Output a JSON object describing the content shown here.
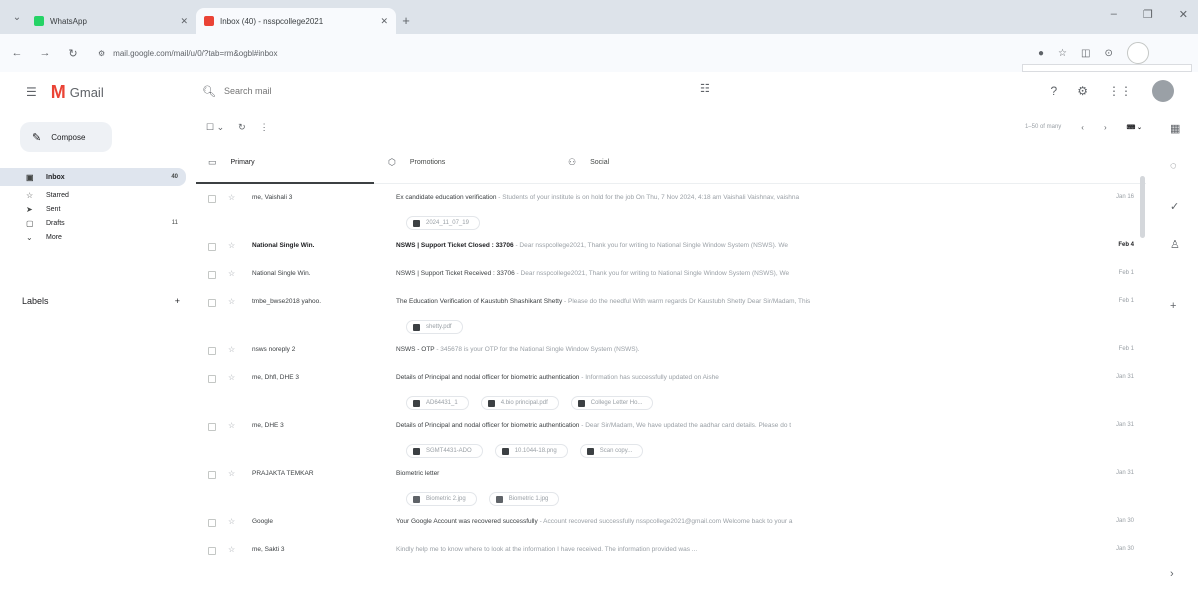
{
  "browser": {
    "tabs": [
      {
        "label": "WhatsApp",
        "favicon_color": "#25d366",
        "active": false
      },
      {
        "label": "Inbox (40) - nsspcollege2021",
        "favicon_color": "#ea4335",
        "active": true
      }
    ],
    "url": "mail.google.com/mail/u/0/?tab=rm&ogbl#inbox"
  },
  "gmail": {
    "app_name": "Gmail",
    "search_placeholder": "Search mail"
  },
  "sidebar": {
    "compose_label": "Compose",
    "items": [
      {
        "icon": "inbox-icon",
        "glyph": "▣",
        "label": "Inbox",
        "count": "40",
        "active": true
      },
      {
        "icon": "star-icon",
        "glyph": "☆",
        "label": "Starred",
        "count": "",
        "active": false
      },
      {
        "icon": "send-icon",
        "glyph": "➤",
        "label": "Sent",
        "count": "",
        "active": false
      },
      {
        "icon": "draft-icon",
        "glyph": "▢",
        "label": "Drafts",
        "count": "11",
        "active": false
      },
      {
        "icon": "chevron-down-icon",
        "glyph": "⌄",
        "label": "More",
        "count": "",
        "active": false
      }
    ],
    "labels_heading": "Labels"
  },
  "toolbar": {
    "pager_text": "1–50 of many"
  },
  "categories": [
    {
      "icon": "primary-icon",
      "glyph": "▭",
      "label": "Primary",
      "active": true
    },
    {
      "icon": "tag-icon",
      "glyph": "⬡",
      "label": "Promotions",
      "active": false
    },
    {
      "icon": "social-icon",
      "glyph": "⚇",
      "label": "Social",
      "active": false
    }
  ],
  "emails": [
    {
      "sender": "me, Vaishali 3",
      "subject": "Ex candidate education verification",
      "snippet": " - Students of your institute is on hold for the job On Thu, 7 Nov 2024, 4:18 am Vaishali Vaishnav, vaishna",
      "date": "Jan 16",
      "unread": false,
      "chips": [
        {
          "name": "2024_11_07_19",
          "kind": "pdf"
        }
      ]
    },
    {
      "sender": "National Single Win.",
      "subject": "NSWS | Support Ticket Closed : 33706",
      "snippet": " - Dear nsspcollege2021, Thank you for writing to National Single Window System (NSWS). We",
      "date": "Feb 4",
      "unread": true,
      "chips": []
    },
    {
      "sender": "National Single Win.",
      "subject": "NSWS | Support Ticket Received : 33706",
      "snippet": " - Dear nsspcollege2021, Thank you for writing to National Single Window System (NSWS), We",
      "date": "Feb 1",
      "unread": false,
      "chips": []
    },
    {
      "sender": "tmbe_bwse2018 yahoo.",
      "subject": "The Education Verification of Kaustubh Shashikant Shetty",
      "snippet": " - Please do the needful With warm regards Dr Kaustubh Shetty Dear Sir/Madam, This",
      "date": "Feb 1",
      "unread": false,
      "chips": [
        {
          "name": "shetty.pdf",
          "kind": "pdf"
        }
      ]
    },
    {
      "sender": "nsws noreply 2",
      "subject": "NSWS - OTP",
      "snippet": " - 345678 is your OTP for the National Single Window System (NSWS).",
      "date": "Feb 1",
      "unread": false,
      "chips": []
    },
    {
      "sender": "me, Dhfl, DHE 3",
      "subject": "Details of Principal and nodal officer for biometric authentication",
      "snippet": " - Information has successfully updated on Aishe",
      "date": "Jan 31",
      "unread": false,
      "chips": [
        {
          "name": "AD64431_1",
          "kind": "pdf"
        },
        {
          "name": "4.bio principal.pdf",
          "kind": "pdf"
        },
        {
          "name": "College Letter Ho...",
          "kind": "pdf"
        }
      ]
    },
    {
      "sender": "me, DHE 3",
      "subject": "Details of Principal and nodal officer for biometric authentication",
      "snippet": " - Dear Sir/Madam, We have updated the aadhar card details. Please do t",
      "date": "Jan 31",
      "unread": false,
      "chips": [
        {
          "name": "SGMT4431-ADO",
          "kind": "pdf"
        },
        {
          "name": "10.1044-18.png",
          "kind": "pdf"
        },
        {
          "name": "Scan copy...",
          "kind": "pdf"
        }
      ]
    },
    {
      "sender": "PRAJAKTA TEMKAR",
      "subject": "Biometric letter",
      "snippet": "",
      "date": "Jan 31",
      "unread": false,
      "chips": [
        {
          "name": "Biometric 2.jpg",
          "kind": "img"
        },
        {
          "name": "Biometric 1.jpg",
          "kind": "img"
        }
      ]
    },
    {
      "sender": "Google",
      "subject": "Your Google Account was recovered successfully",
      "snippet": " - Account recovered successfully nsspcollege2021@gmail.com Welcome back to your a",
      "date": "Jan 30",
      "unread": false,
      "chips": []
    },
    {
      "sender": "me, Sakti 3",
      "subject": "",
      "snippet": "Kindly help me to know where to look at the information I have received. The information provided was ...",
      "date": "Jan 30",
      "unread": false,
      "chips": []
    }
  ]
}
